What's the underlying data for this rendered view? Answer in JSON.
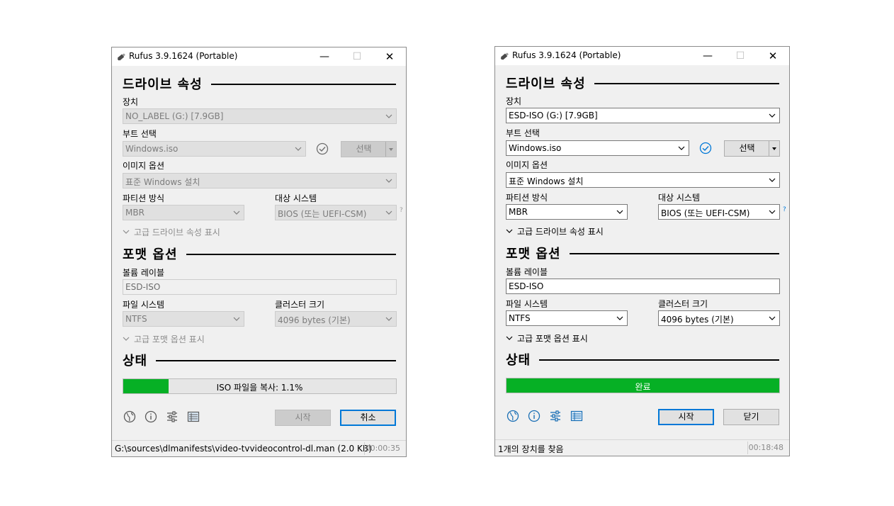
{
  "windows": [
    {
      "title": "Rufus 3.9.1624 (Portable)",
      "sections": {
        "drive": "드라이브 속성",
        "format": "포맷 옵션",
        "status": "상태"
      },
      "labels": {
        "device": "장치",
        "boot": "부트 선택",
        "image_option": "이미지 옵션",
        "partition": "파티션 방식",
        "target": "대상 시스템",
        "volume": "볼륨 레이블",
        "filesystem": "파일 시스템",
        "cluster": "클러스터 크기"
      },
      "values": {
        "device": "NO_LABEL (G:) [7.9GB]",
        "boot": "Windows.iso",
        "image_option": "표준 Windows 설치",
        "partition": "MBR",
        "target": "BIOS (또는 UEFI-CSM)",
        "volume": "ESD-ISO",
        "filesystem": "NTFS",
        "cluster": "4096 bytes (기본)"
      },
      "select_button": "선택",
      "help": "?",
      "adv_drive": "고급 드라이브 속성 표시",
      "adv_format": "고급 포맷 옵션 표시",
      "progress_text": "ISO 파일을 복사: 1.1%",
      "progress_fill": 0.165,
      "start_button": "시작",
      "second_button": "취소",
      "status_text": "G:\\sources\\dlmanifests\\video-tvvideocontrol-dl.man (2.0 KB)",
      "status_time": "00:00:35",
      "state": "in-progress"
    },
    {
      "title": "Rufus 3.9.1624 (Portable)",
      "sections": {
        "drive": "드라이브 속성",
        "format": "포맷 옵션",
        "status": "상태"
      },
      "labels": {
        "device": "장치",
        "boot": "부트 선택",
        "image_option": "이미지 옵션",
        "partition": "파티션 방식",
        "target": "대상 시스템",
        "volume": "볼륨 레이블",
        "filesystem": "파일 시스템",
        "cluster": "클러스터 크기"
      },
      "values": {
        "device": "ESD-ISO (G:) [7.9GB]",
        "boot": "Windows.iso",
        "image_option": "표준 Windows 설치",
        "partition": "MBR",
        "target": "BIOS (또는 UEFI-CSM)",
        "volume": "ESD-ISO",
        "filesystem": "NTFS",
        "cluster": "4096 bytes (기본)"
      },
      "select_button": "선택",
      "help": "?",
      "adv_drive": "고급 드라이브 속성 표시",
      "adv_format": "고급 포맷 옵션 표시",
      "progress_text": "완료",
      "progress_fill": 1.0,
      "start_button": "시작",
      "second_button": "닫기",
      "status_text": "1개의 장치를 찾음",
      "status_time": "00:18:48",
      "state": "complete"
    }
  ],
  "titlebar_buttons": {
    "minimize": "—",
    "maximize": "☐",
    "close": "✕"
  },
  "colors": {
    "progress": "#06b025",
    "accent": "#0078d7",
    "window_bg": "#f0f0f0"
  },
  "icons": [
    "language-globe-icon",
    "info-icon",
    "settings-sliders-icon",
    "log-icon",
    "checksum-check-icon",
    "rufus-usb-icon"
  ]
}
